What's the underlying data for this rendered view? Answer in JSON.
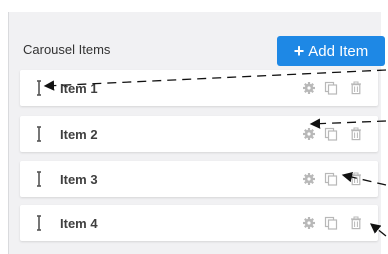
{
  "panel": {
    "title": "Carousel Items",
    "add_button_label": "Add Item",
    "add_button_icon": "plus-icon"
  },
  "items": [
    {
      "label": "Item 1"
    },
    {
      "label": "Item 2"
    },
    {
      "label": "Item 3"
    },
    {
      "label": "Item 4"
    }
  ],
  "row_icons": [
    "drag-handle-icon",
    "gear-icon",
    "copy-icon",
    "trash-icon"
  ],
  "colors": {
    "accent": "#1e88e5",
    "panel_bg": "#f1f1f3",
    "icon": "#b8b8b8"
  }
}
